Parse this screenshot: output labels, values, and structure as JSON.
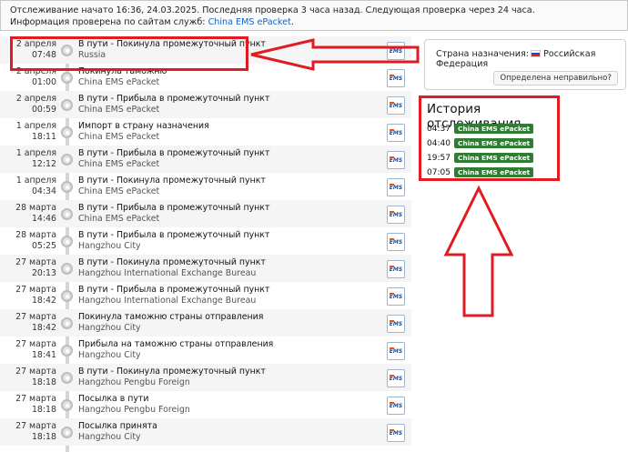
{
  "info": {
    "line1": "Отслеживание начато 16:36, 24.03.2025. Последняя проверка 3 часа назад. Следующая проверка через 24 часа.",
    "line2_prefix": "Информация проверена по сайтам служб:",
    "service_link": "China EMS ePacket",
    "line2_suffix": "."
  },
  "events": [
    {
      "date": "2 апреля",
      "time": "07:48",
      "status": "В пути",
      "sep": " - ",
      "detail": "Покинула промежуточный пункт",
      "location": "Russia",
      "carrier_icon": "ems-logo-icon",
      "carrier_label": "EMS"
    },
    {
      "date": "2 апреля",
      "time": "01:00",
      "status": "Покинула таможню",
      "sep": "",
      "detail": "",
      "location": "China EMS ePacket",
      "carrier_icon": "ems-logo-icon",
      "carrier_label": "EMS"
    },
    {
      "date": "2 апреля",
      "time": "00:59",
      "status": "В пути",
      "sep": " - ",
      "detail": "Прибыла в промежуточный пункт",
      "location": "China EMS ePacket",
      "carrier_icon": "ems-logo-icon",
      "carrier_label": "EMS"
    },
    {
      "date": "1 апреля",
      "time": "18:11",
      "status": "Импорт в страну назначения",
      "sep": "",
      "detail": "",
      "location": "China EMS ePacket",
      "carrier_icon": "ems-logo-icon",
      "carrier_label": "EMS"
    },
    {
      "date": "1 апреля",
      "time": "12:12",
      "status": "В пути",
      "sep": " - ",
      "detail": "Прибыла в промежуточный пункт",
      "location": "China EMS ePacket",
      "carrier_icon": "ems-logo-icon",
      "carrier_label": "EMS"
    },
    {
      "date": "1 апреля",
      "time": "04:34",
      "status": "В пути",
      "sep": " - ",
      "detail": "Покинула промежуточный пункт",
      "location": "China EMS ePacket",
      "carrier_icon": "ems-logo-icon",
      "carrier_label": "EMS"
    },
    {
      "date": "28 марта",
      "time": "14:46",
      "status": "В пути",
      "sep": " - ",
      "detail": "Прибыла в промежуточный пункт",
      "location": "China EMS ePacket",
      "carrier_icon": "ems-logo-icon",
      "carrier_label": "EMS"
    },
    {
      "date": "28 марта",
      "time": "05:25",
      "status": "В пути",
      "sep": " - ",
      "detail": "Прибыла в промежуточный пункт",
      "location": "Hangzhou City",
      "carrier_icon": "ems-logo-icon",
      "carrier_label": "EMS"
    },
    {
      "date": "27 марта",
      "time": "20:13",
      "status": "В пути",
      "sep": " - ",
      "detail": "Покинула промежуточный пункт",
      "location": "Hangzhou International Exchange Bureau",
      "carrier_icon": "ems-logo-icon",
      "carrier_label": "EMS"
    },
    {
      "date": "27 марта",
      "time": "18:42",
      "status": "В пути",
      "sep": " - ",
      "detail": "Прибыла в промежуточный пункт",
      "location": "Hangzhou International Exchange Bureau",
      "carrier_icon": "ems-logo-icon",
      "carrier_label": "EMS"
    },
    {
      "date": "27 марта",
      "time": "18:42",
      "status": "Покинула таможню страны отправления",
      "sep": "",
      "detail": "",
      "location": "Hangzhou City",
      "carrier_icon": "ems-logo-icon",
      "carrier_label": "EMS"
    },
    {
      "date": "27 марта",
      "time": "18:41",
      "status": "Прибыла на таможню страны отправления",
      "sep": "",
      "detail": "",
      "location": "Hangzhou City",
      "carrier_icon": "ems-logo-icon",
      "carrier_label": "EMS"
    },
    {
      "date": "27 марта",
      "time": "18:18",
      "status": "В пути",
      "sep": " - ",
      "detail": "Покинула промежуточный пункт",
      "location": "Hangzhou Pengbu Foreign",
      "carrier_icon": "ems-logo-icon",
      "carrier_label": "EMS"
    },
    {
      "date": "27 марта",
      "time": "18:18",
      "status": "Посылка в пути",
      "sep": "",
      "detail": "",
      "location": "Hangzhou Pengbu Foreign",
      "carrier_icon": "ems-logo-icon",
      "carrier_label": "EMS"
    },
    {
      "date": "27 марта",
      "time": "18:18",
      "status": "Посылка принята",
      "sep": "",
      "detail": "",
      "location": "Hangzhou City",
      "carrier_icon": "ems-logo-icon",
      "carrier_label": "EMS"
    }
  ],
  "destination": {
    "label": "Страна назначения:",
    "country": "Российская Федерация",
    "flag_icon": "russia-flag-icon",
    "wrong_button": "Определена неправильно?"
  },
  "history": {
    "title": "История отслеживания",
    "items": [
      {
        "time": "04:37",
        "service": "China EMS ePacket"
      },
      {
        "time": "04:40",
        "service": "China EMS ePacket"
      },
      {
        "time": "19:57",
        "service": "China EMS ePacket"
      },
      {
        "time": "07:05",
        "service": "China EMS ePacket"
      }
    ]
  },
  "colors": {
    "annotation_red": "#e01b24",
    "badge_green": "#2e7d32",
    "link_blue": "#1565c0"
  }
}
